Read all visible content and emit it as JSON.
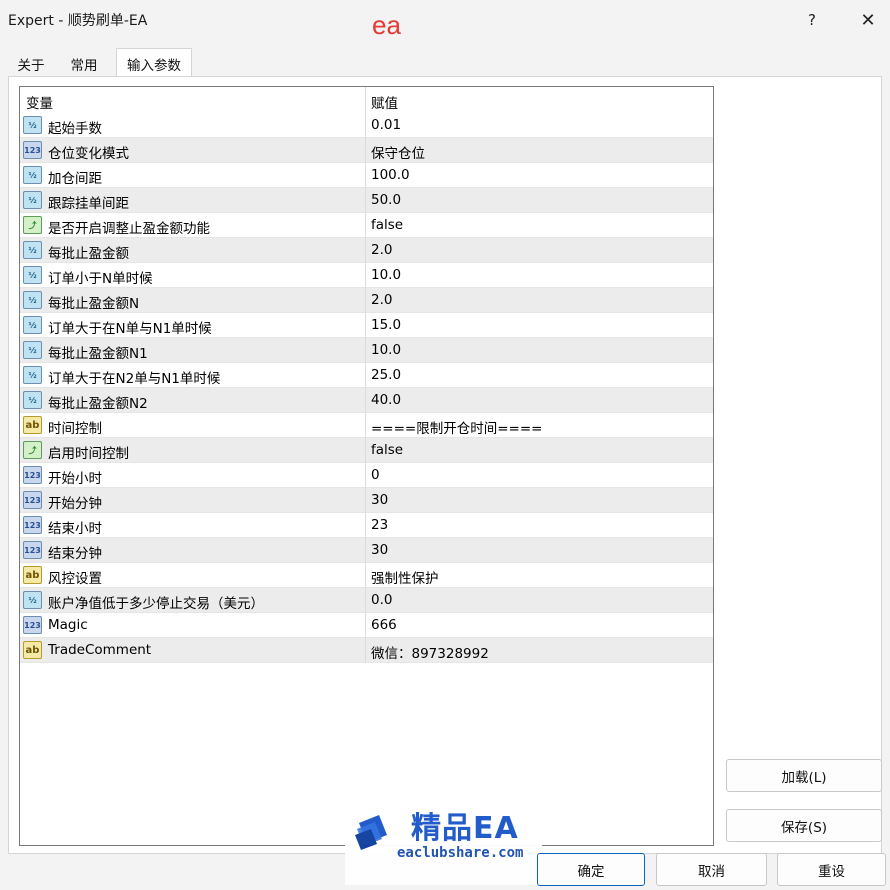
{
  "window": {
    "title": "Expert - 顺势刷单-EA",
    "overlay_text": "ea",
    "help_label": "?",
    "close_label": "✕"
  },
  "tabs": [
    {
      "label": "关于"
    },
    {
      "label": "常用"
    },
    {
      "label": "输入参数"
    }
  ],
  "table": {
    "headers": {
      "variable": "变量",
      "value": "赋值"
    },
    "rows": [
      {
        "type": "double",
        "name": "起始手数",
        "value": "0.01"
      },
      {
        "type": "int",
        "name": "仓位变化模式",
        "value": "保守仓位"
      },
      {
        "type": "double",
        "name": "加仓间距",
        "value": "100.0"
      },
      {
        "type": "double",
        "name": "跟踪挂单间距",
        "value": "50.0"
      },
      {
        "type": "bool",
        "name": "是否开启调整止盈金额功能",
        "value": "false"
      },
      {
        "type": "double",
        "name": "每批止盈金额",
        "value": "2.0"
      },
      {
        "type": "double",
        "name": "订单小于N单时候",
        "value": "10.0"
      },
      {
        "type": "double",
        "name": "每批止盈金额N",
        "value": "2.0"
      },
      {
        "type": "double",
        "name": "订单大于在N单与N1单时候",
        "value": "15.0"
      },
      {
        "type": "double",
        "name": "每批止盈金额N1",
        "value": "10.0"
      },
      {
        "type": "double",
        "name": "订单大于在N2单与N1单时候",
        "value": "25.0"
      },
      {
        "type": "double",
        "name": "每批止盈金额N2",
        "value": "40.0"
      },
      {
        "type": "string",
        "name": "时间控制",
        "value": "====限制开仓时间===="
      },
      {
        "type": "bool",
        "name": "启用时间控制",
        "value": "false"
      },
      {
        "type": "int",
        "name": "开始小时",
        "value": "0"
      },
      {
        "type": "int",
        "name": "开始分钟",
        "value": "30"
      },
      {
        "type": "int",
        "name": "结束小时",
        "value": "23"
      },
      {
        "type": "int",
        "name": "结束分钟",
        "value": "30"
      },
      {
        "type": "string",
        "name": "风控设置",
        "value": "强制性保护"
      },
      {
        "type": "double",
        "name": "账户净值低于多少停止交易（美元）",
        "value": "0.0"
      },
      {
        "type": "int",
        "name": "Magic",
        "value": "666"
      },
      {
        "type": "string",
        "name": "TradeComment",
        "value": "微信：897328992"
      }
    ]
  },
  "icon_glyphs": {
    "double": "½",
    "int": "123",
    "bool": "⤴",
    "string": "ab"
  },
  "buttons": {
    "load": "加载(L)",
    "save": "保存(S)",
    "ok": "确定",
    "cancel": "取消",
    "reset": "重设"
  },
  "watermark": {
    "title": "精品EA",
    "url": "eaclubshare.com"
  },
  "colors": {
    "accent": "#0a64c8",
    "watermark_blue": "#1a56c8",
    "overlay_red": "#e53935"
  }
}
